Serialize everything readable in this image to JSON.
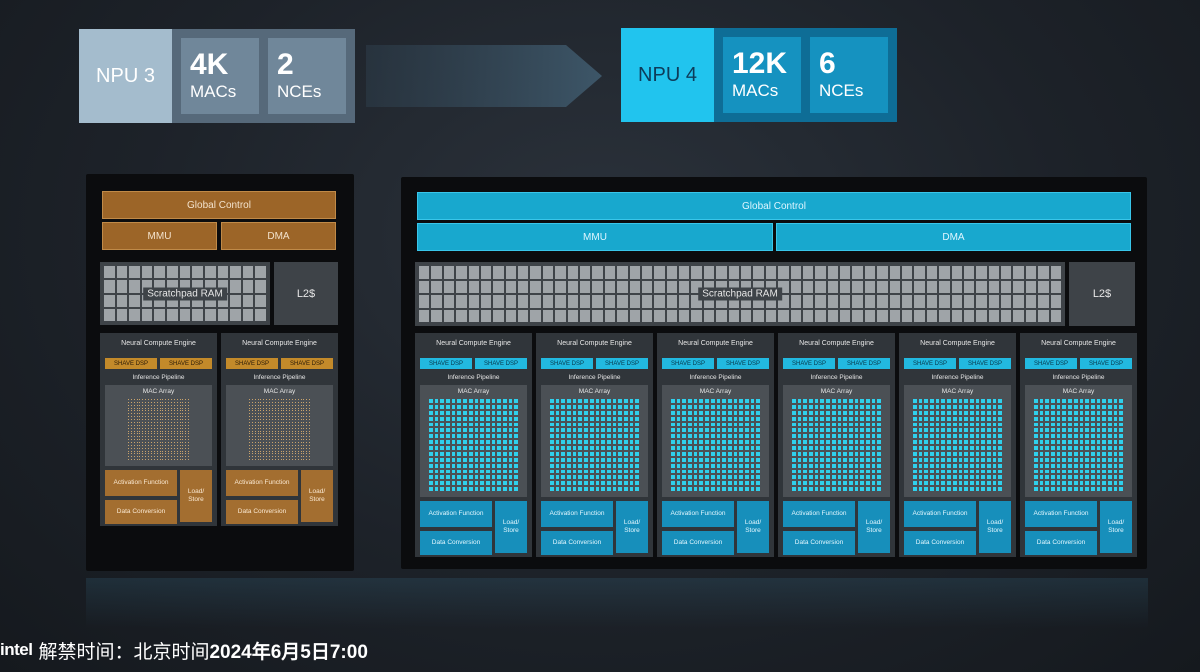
{
  "header": {
    "npu3": {
      "name": "NPU 3",
      "macs_value": "4K",
      "macs_label": "MACs",
      "nces_value": "2",
      "nces_label": "NCEs"
    },
    "npu4": {
      "name": "NPU 4",
      "macs_value": "12K",
      "macs_label": "MACs",
      "nces_value": "6",
      "nces_label": "NCEs"
    }
  },
  "diagram": {
    "global_control": "Global Control",
    "mmu": "MMU",
    "dma": "DMA",
    "scratchpad": "Scratchpad RAM",
    "l2": "L2$",
    "nce_title": "Neural Compute Engine",
    "shave_dsp": "SHAVE DSP",
    "inference_pipeline": "Inference Pipeline",
    "mac_array": "MAC Array",
    "activation": "Activation Function",
    "load_store": "Load/ Store",
    "data_conversion": "Data Conversion"
  },
  "colors": {
    "npu3_accent": "#9c6528",
    "npu4_accent": "#18a8ce"
  },
  "caption": {
    "logo": "intel",
    "prefix": "解禁时间：北京时间",
    "date": "2024年6月5日7:00"
  }
}
